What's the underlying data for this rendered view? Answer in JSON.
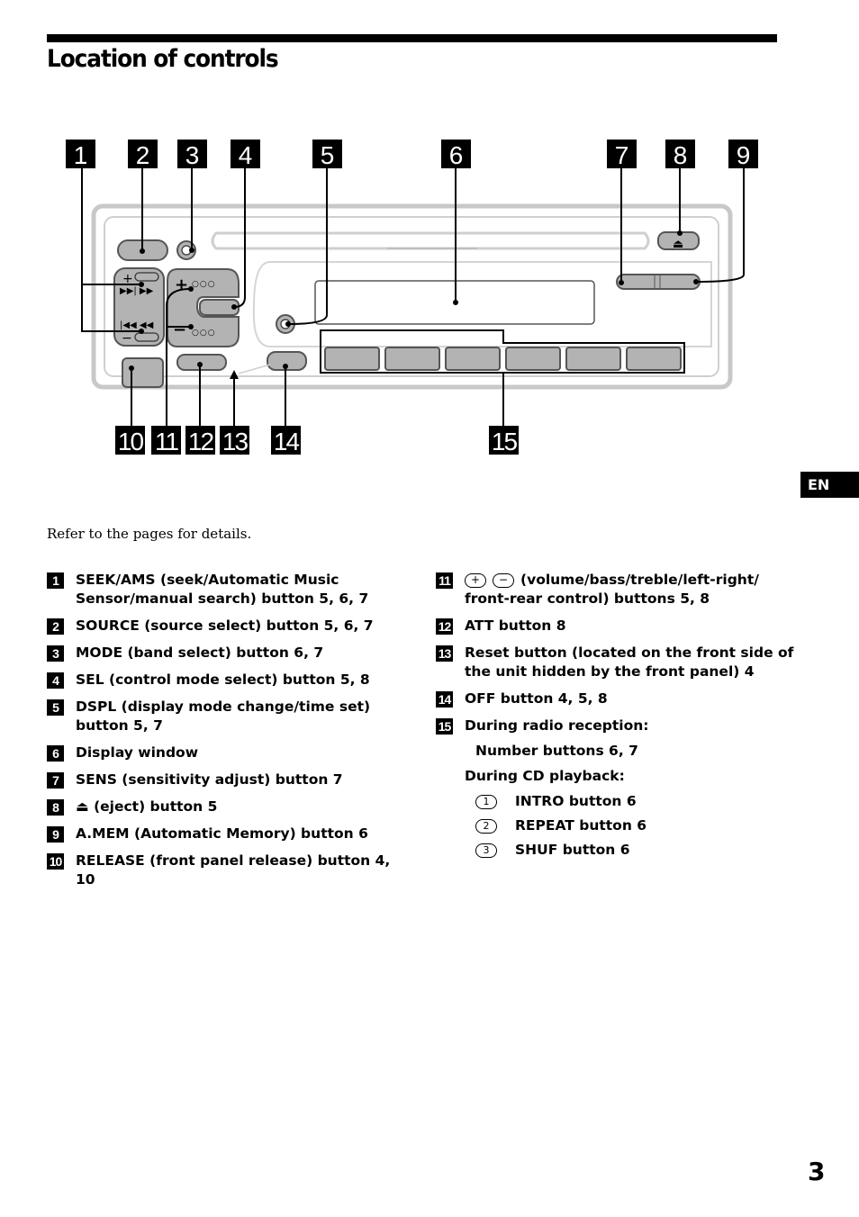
{
  "page": {
    "title": "Location of controls",
    "language_tab": "EN",
    "page_number": "3",
    "intro": "Refer to the pages for details."
  },
  "diagram": {
    "callouts_top": [
      "1",
      "2",
      "3",
      "4",
      "5",
      "6",
      "7",
      "8",
      "9"
    ],
    "callouts_bottom": [
      "10",
      "11",
      "12",
      "13",
      "14",
      "15"
    ],
    "colors": {
      "button_fill": "#b3b3b3",
      "button_stroke": "#555555",
      "panel_stroke": "#c8c8c8",
      "ink": "#000000"
    }
  },
  "legend_left": [
    {
      "num": "1",
      "text": "SEEK/AMS (seek/Automatic Music Sensor/manual search) button  5, 6, 7"
    },
    {
      "num": "2",
      "text": "SOURCE (source select) button  5, 6, 7"
    },
    {
      "num": "3",
      "text": "MODE (band select) button  6, 7"
    },
    {
      "num": "4",
      "text": "SEL (control mode select) button  5, 8"
    },
    {
      "num": "5",
      "text": "DSPL (display mode change/time set) button  5, 7"
    },
    {
      "num": "6",
      "text": "Display window"
    },
    {
      "num": "7",
      "text": "SENS (sensitivity adjust) button  7"
    },
    {
      "num": "8",
      "icon": "eject-icon",
      "icon_glyph": "⏏",
      "text": "(eject) button  5"
    },
    {
      "num": "9",
      "text": "A.MEM (Automatic Memory) button  6"
    },
    {
      "num": "10",
      "text": "RELEASE (front panel release) button  4, 10"
    }
  ],
  "legend_right": [
    {
      "num": "11",
      "plus_glyph": "+",
      "minus_glyph": "−",
      "text": "(volume/bass/treble/left-right/ front-rear control) buttons  5, 8"
    },
    {
      "num": "12",
      "text": "ATT button  8"
    },
    {
      "num": "13",
      "text": "Reset button (located on the front side of the unit hidden by the front panel)  4"
    },
    {
      "num": "14",
      "text": "OFF button  4, 5, 8"
    },
    {
      "num": "15",
      "text": "During radio reception:",
      "radio_sub": "Number buttons  6, 7",
      "cd_heading": "During CD playback:",
      "cd_items": [
        {
          "circled": "1",
          "text": "INTRO button  6"
        },
        {
          "circled": "2",
          "text": "REPEAT button  6"
        },
        {
          "circled": "3",
          "text": "SHUF button  6"
        }
      ]
    }
  ]
}
